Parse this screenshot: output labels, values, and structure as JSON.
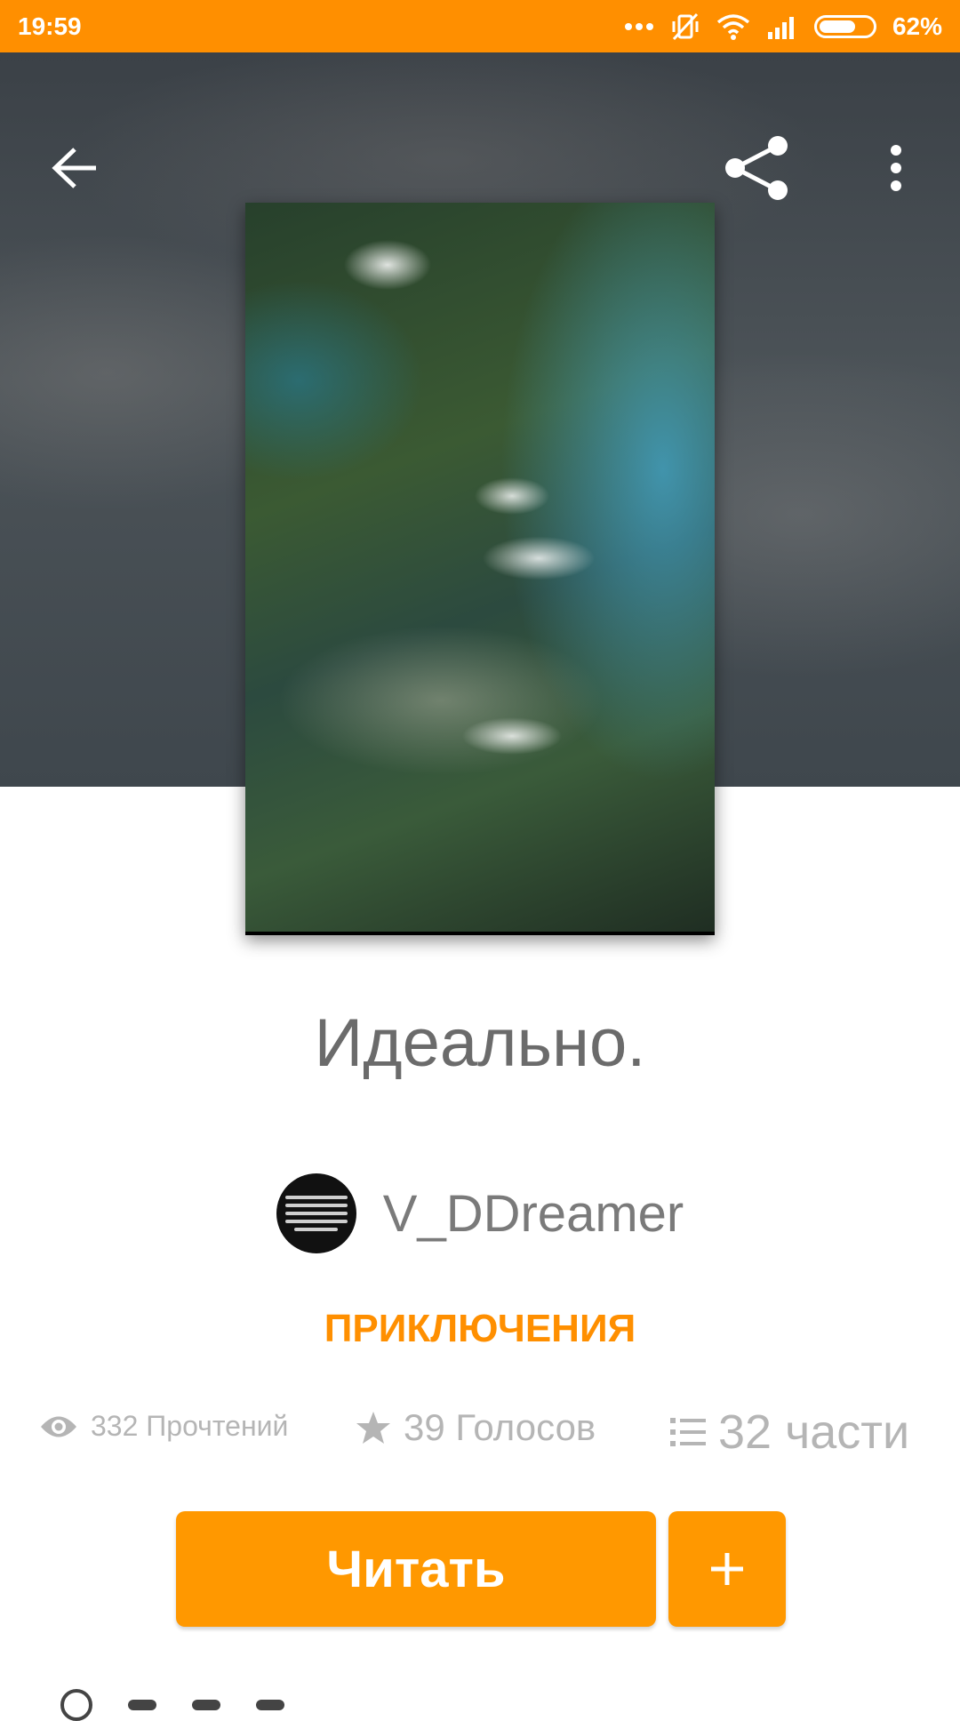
{
  "status_bar": {
    "time": "19:59",
    "battery_text": "62%",
    "battery_level": 0.62,
    "icons": [
      "more-dots-icon",
      "vibrate-off-icon",
      "wifi-icon",
      "signal-icon",
      "battery-icon"
    ]
  },
  "toolbar": {
    "back_icon": "arrow-left-icon",
    "share_icon": "share-icon",
    "menu_icon": "more-vert-icon"
  },
  "story": {
    "title": "Идеально.",
    "author": "V_DDreamer",
    "category": "ПРИКЛЮЧЕНИЯ"
  },
  "stats": {
    "reads": "332 Прочтений",
    "votes": "39 Голосов",
    "parts": "32 части"
  },
  "actions": {
    "read_label": "Читать",
    "add_label": "+"
  },
  "colors": {
    "accent": "#ff8f00",
    "button": "#ff9800",
    "title_text": "#6b6b6b",
    "stats_text": "#b5b5b5"
  }
}
